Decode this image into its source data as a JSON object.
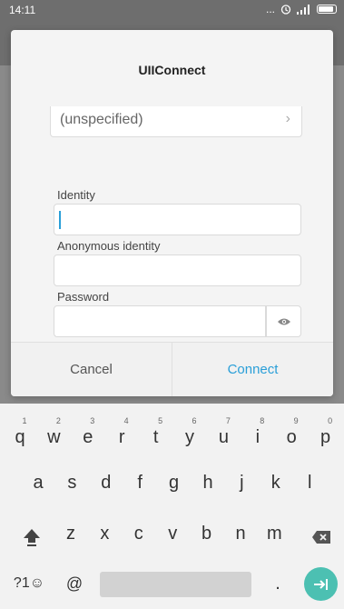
{
  "status_bar": {
    "time": "14:11",
    "dots": "..."
  },
  "dialog": {
    "title": "UIIConnect",
    "dropdown_value": "(unspecified)",
    "identity_label": "Identity",
    "identity_value": "",
    "anon_label": "Anonymous identity",
    "anon_value": "",
    "password_label": "Password",
    "password_value": "",
    "cancel_label": "Cancel",
    "connect_label": "Connect"
  },
  "keyboard": {
    "row1": [
      {
        "ch": "q",
        "num": "1"
      },
      {
        "ch": "w",
        "num": "2"
      },
      {
        "ch": "e",
        "num": "3"
      },
      {
        "ch": "r",
        "num": "4"
      },
      {
        "ch": "t",
        "num": "5"
      },
      {
        "ch": "y",
        "num": "6"
      },
      {
        "ch": "u",
        "num": "7"
      },
      {
        "ch": "i",
        "num": "8"
      },
      {
        "ch": "o",
        "num": "9"
      },
      {
        "ch": "p",
        "num": "0"
      }
    ],
    "row2": [
      "a",
      "s",
      "d",
      "f",
      "g",
      "h",
      "j",
      "k",
      "l"
    ],
    "row3": [
      "z",
      "x",
      "c",
      "v",
      "b",
      "n",
      "m"
    ],
    "symbols_label": "?1☺",
    "at_label": "@",
    "period_label": "."
  },
  "colors": {
    "accent": "#2a9fd8",
    "enter": "#4cc0b2"
  },
  "icons": [
    "chevron-right-icon",
    "eye-icon",
    "shift-icon",
    "backspace-icon",
    "enter-icon",
    "alarm-icon",
    "signal-icon",
    "battery-icon"
  ]
}
